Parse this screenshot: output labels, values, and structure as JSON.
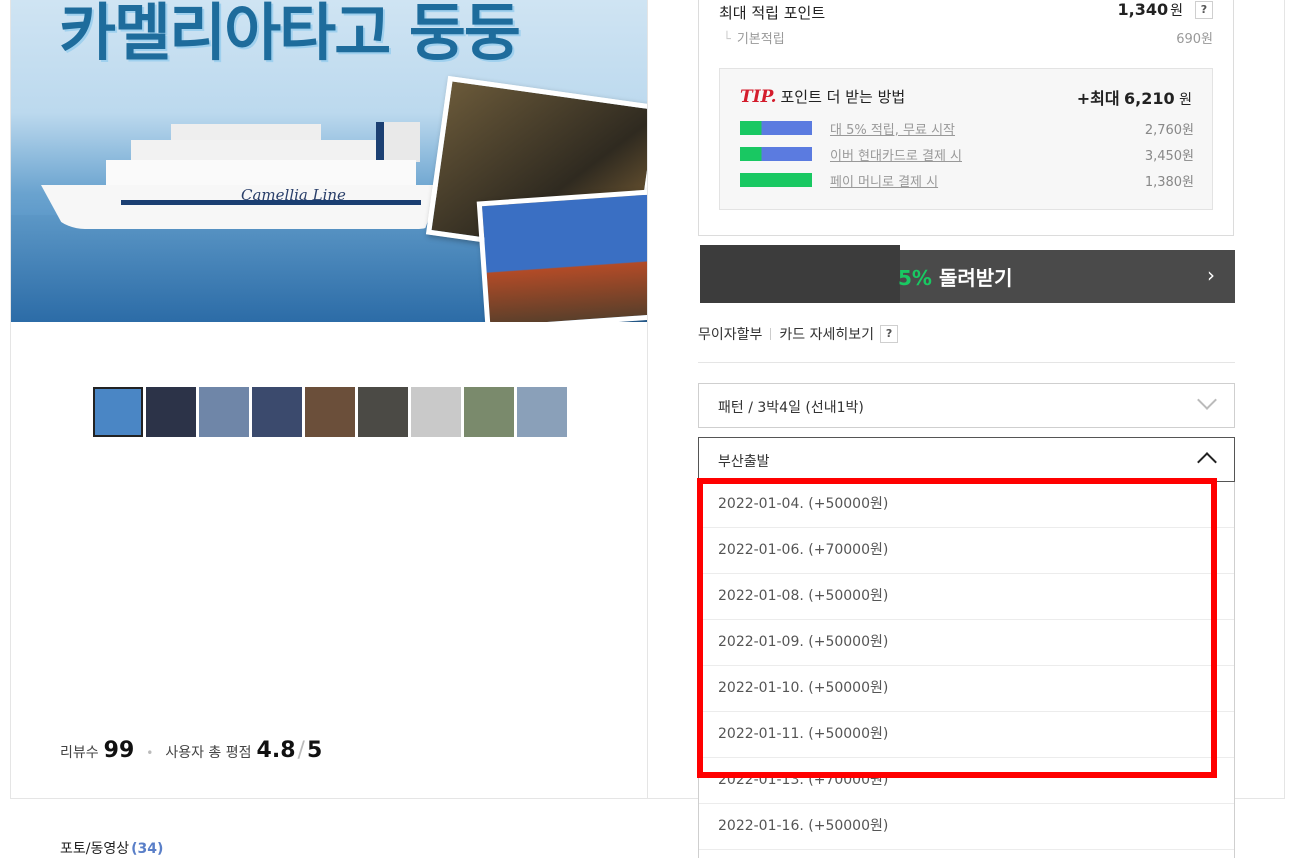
{
  "hero": {
    "title": "카멜리아타고 둥둥",
    "ship_name": "Camellia Line"
  },
  "thumbnails": [
    {
      "color": "#4a86c5"
    },
    {
      "color": "#2c3348"
    },
    {
      "color": "#6f86a8"
    },
    {
      "color": "#3b4a6d"
    },
    {
      "color": "#6b4f3a"
    },
    {
      "color": "#4b4a45"
    },
    {
      "color": "#c9c9c9"
    },
    {
      "color": "#7a8a6c"
    },
    {
      "color": "#8aa0b9"
    }
  ],
  "rating": {
    "review_label": "리뷰수",
    "review_count": "99",
    "score_label": "사용자 총 평점",
    "score": "4.8",
    "score_max": "5"
  },
  "photo_review": {
    "label": "포토/동영상",
    "count": "(34)"
  },
  "points": {
    "max_label": "최대 적립 포인트",
    "max_value": "1,340",
    "won": "원",
    "help": "?",
    "base_label": "기본적립",
    "base_value": "690원"
  },
  "tip": {
    "tip_word": "TIP.",
    "title": "포인트 더 받는 방법",
    "max_prefix": "+최대",
    "max_value": "6,210",
    "won": "원",
    "rows": [
      {
        "desc": "대 5% 적립, 무료 시작",
        "amount": "2,760원",
        "logo_color": "#5b7be0"
      },
      {
        "desc": "이버 현대카드로 결제 시",
        "amount": "3,450원",
        "logo_color": "#5b7be0"
      },
      {
        "desc": "페이 머니로 결제 시",
        "amount": "1,380원",
        "logo_color": "#19c862"
      }
    ]
  },
  "cashback": {
    "pct": "5%",
    "text": "돌려받기",
    "arrow": "›"
  },
  "installment": {
    "interest_free": "무이자할부",
    "card_detail": "카드 자세히보기",
    "help": "?"
  },
  "select1": {
    "value": "패턴 / 3박4일 (선내1박)"
  },
  "select2": {
    "value": "부산출발"
  },
  "dropdown_options": [
    "2022-01-04. (+50000원)",
    "2022-01-06. (+70000원)",
    "2022-01-08. (+50000원)",
    "2022-01-09. (+50000원)",
    "2022-01-10. (+50000원)",
    "2022-01-11. (+50000원)",
    "2022-01-13. (+70000원)",
    "2022-01-16. (+50000원)"
  ]
}
